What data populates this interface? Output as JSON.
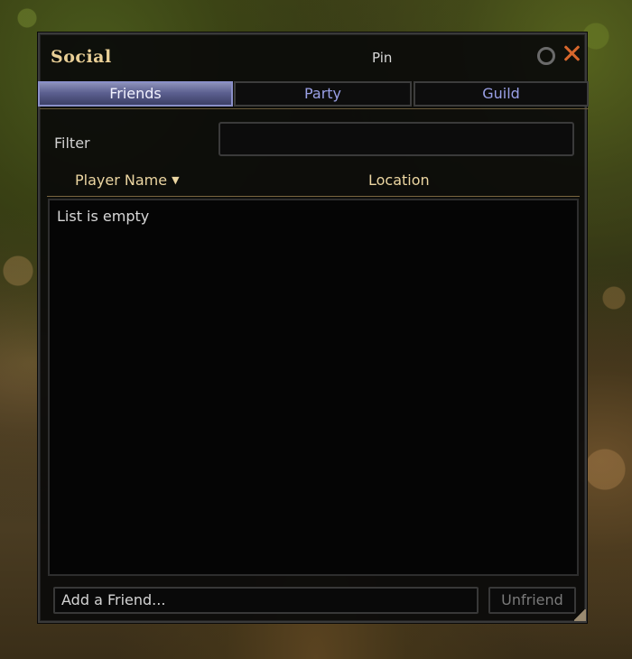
{
  "window": {
    "title": "Social",
    "pin_label": "Pin"
  },
  "tabs": [
    {
      "label": "Friends",
      "active": true
    },
    {
      "label": "Party",
      "active": false
    },
    {
      "label": "Guild",
      "active": false
    }
  ],
  "filter": {
    "label": "Filter",
    "value": ""
  },
  "columns": {
    "player_name": "Player Name",
    "location": "Location"
  },
  "list": {
    "empty_message": "List is empty"
  },
  "footer": {
    "add_friend_placeholder": "Add a Friend...",
    "unfriend_label": "Unfriend"
  },
  "colors": {
    "title": "#e9cf96",
    "header_text": "#ecd6a2",
    "tab_text": "#9aa0e6",
    "close": "#d7672d"
  }
}
